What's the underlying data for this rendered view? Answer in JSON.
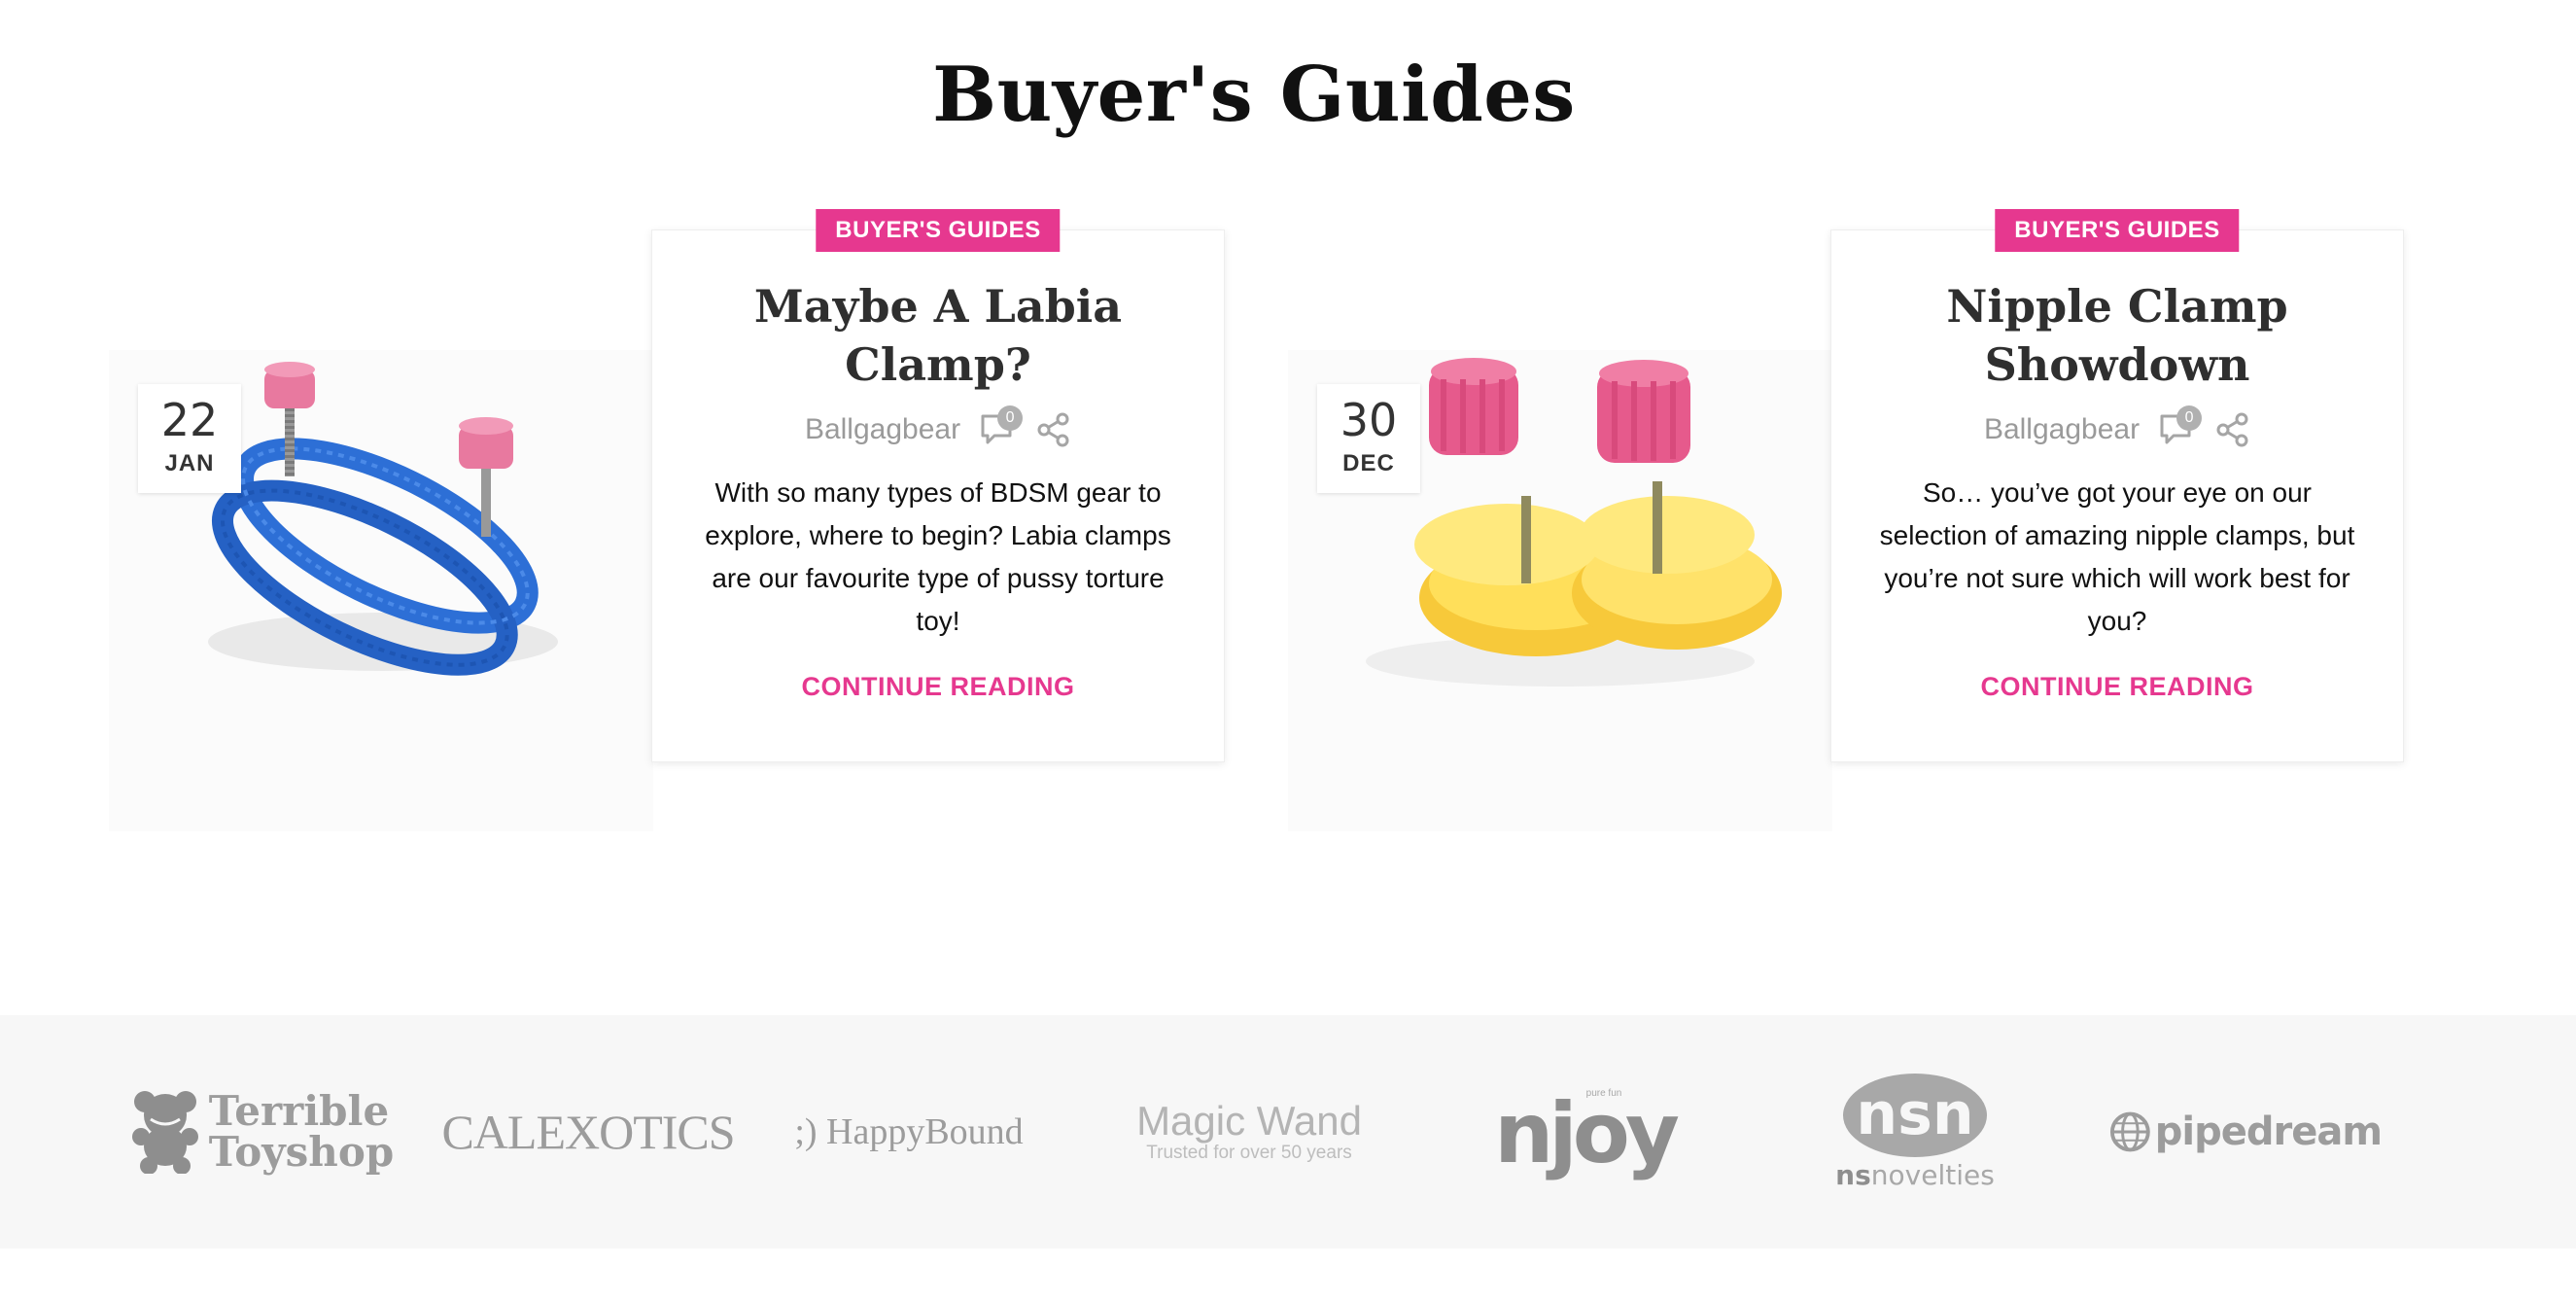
{
  "section": {
    "title": "Buyer's Guides"
  },
  "posts": [
    {
      "day": "22",
      "month": "JAN",
      "category": "BUYER'S GUIDES",
      "title": "Maybe A Labia Clamp?",
      "author": "Ballgagbear",
      "comments": "0",
      "excerpt": "With so many types of BDSM gear to explore, where to begin? Labia clamps are our favourite type of pussy torture toy!",
      "read_more": "CONTINUE READING"
    },
    {
      "day": "30",
      "month": "DEC",
      "category": "BUYER'S GUIDES",
      "title": "Nipple Clamp Showdown",
      "author": "Ballgagbear",
      "comments": "0",
      "excerpt": "So… you’ve got your eye on our selection of amazing nipple clamps, but you’re not sure which will work best for you?",
      "read_more": "CONTINUE READING"
    }
  ],
  "brands": {
    "terrible_line1": "Terrible",
    "terrible_line2": "Toyshop",
    "calexotics": "CALEXOTICS",
    "happybound": ";) HappyBound",
    "magicwand": "Magic Wand",
    "magicwand_sub": "Trusted for over 50 years",
    "njoy": "njoy",
    "njoy_small": "pure fun",
    "nsn": "nsn",
    "nsnovelties_ns": "ns",
    "nsnovelties_rest": "novelties",
    "pipedream": "pipedream"
  },
  "colors": {
    "accent": "#e6388f",
    "brand_gray": "#9c9c9c",
    "strip_bg": "#f7f7f7"
  }
}
